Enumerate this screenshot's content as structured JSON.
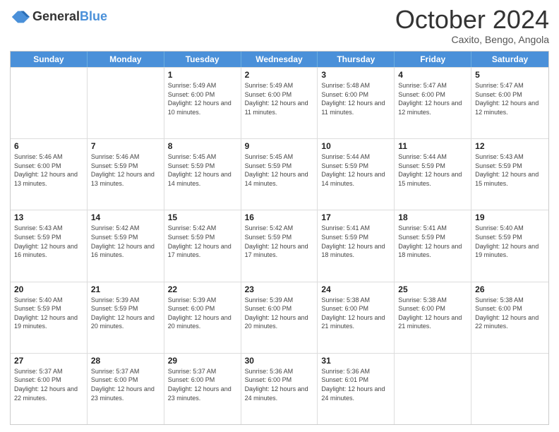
{
  "header": {
    "logo_general": "General",
    "logo_blue": "Blue",
    "month_title": "October 2024",
    "location": "Caxito, Bengo, Angola"
  },
  "days_of_week": [
    "Sunday",
    "Monday",
    "Tuesday",
    "Wednesday",
    "Thursday",
    "Friday",
    "Saturday"
  ],
  "weeks": [
    [
      {
        "day": "",
        "info": ""
      },
      {
        "day": "",
        "info": ""
      },
      {
        "day": "1",
        "info": "Sunrise: 5:49 AM\nSunset: 6:00 PM\nDaylight: 12 hours and 10 minutes."
      },
      {
        "day": "2",
        "info": "Sunrise: 5:49 AM\nSunset: 6:00 PM\nDaylight: 12 hours and 11 minutes."
      },
      {
        "day": "3",
        "info": "Sunrise: 5:48 AM\nSunset: 6:00 PM\nDaylight: 12 hours and 11 minutes."
      },
      {
        "day": "4",
        "info": "Sunrise: 5:47 AM\nSunset: 6:00 PM\nDaylight: 12 hours and 12 minutes."
      },
      {
        "day": "5",
        "info": "Sunrise: 5:47 AM\nSunset: 6:00 PM\nDaylight: 12 hours and 12 minutes."
      }
    ],
    [
      {
        "day": "6",
        "info": "Sunrise: 5:46 AM\nSunset: 6:00 PM\nDaylight: 12 hours and 13 minutes."
      },
      {
        "day": "7",
        "info": "Sunrise: 5:46 AM\nSunset: 5:59 PM\nDaylight: 12 hours and 13 minutes."
      },
      {
        "day": "8",
        "info": "Sunrise: 5:45 AM\nSunset: 5:59 PM\nDaylight: 12 hours and 14 minutes."
      },
      {
        "day": "9",
        "info": "Sunrise: 5:45 AM\nSunset: 5:59 PM\nDaylight: 12 hours and 14 minutes."
      },
      {
        "day": "10",
        "info": "Sunrise: 5:44 AM\nSunset: 5:59 PM\nDaylight: 12 hours and 14 minutes."
      },
      {
        "day": "11",
        "info": "Sunrise: 5:44 AM\nSunset: 5:59 PM\nDaylight: 12 hours and 15 minutes."
      },
      {
        "day": "12",
        "info": "Sunrise: 5:43 AM\nSunset: 5:59 PM\nDaylight: 12 hours and 15 minutes."
      }
    ],
    [
      {
        "day": "13",
        "info": "Sunrise: 5:43 AM\nSunset: 5:59 PM\nDaylight: 12 hours and 16 minutes."
      },
      {
        "day": "14",
        "info": "Sunrise: 5:42 AM\nSunset: 5:59 PM\nDaylight: 12 hours and 16 minutes."
      },
      {
        "day": "15",
        "info": "Sunrise: 5:42 AM\nSunset: 5:59 PM\nDaylight: 12 hours and 17 minutes."
      },
      {
        "day": "16",
        "info": "Sunrise: 5:42 AM\nSunset: 5:59 PM\nDaylight: 12 hours and 17 minutes."
      },
      {
        "day": "17",
        "info": "Sunrise: 5:41 AM\nSunset: 5:59 PM\nDaylight: 12 hours and 18 minutes."
      },
      {
        "day": "18",
        "info": "Sunrise: 5:41 AM\nSunset: 5:59 PM\nDaylight: 12 hours and 18 minutes."
      },
      {
        "day": "19",
        "info": "Sunrise: 5:40 AM\nSunset: 5:59 PM\nDaylight: 12 hours and 19 minutes."
      }
    ],
    [
      {
        "day": "20",
        "info": "Sunrise: 5:40 AM\nSunset: 5:59 PM\nDaylight: 12 hours and 19 minutes."
      },
      {
        "day": "21",
        "info": "Sunrise: 5:39 AM\nSunset: 5:59 PM\nDaylight: 12 hours and 20 minutes."
      },
      {
        "day": "22",
        "info": "Sunrise: 5:39 AM\nSunset: 6:00 PM\nDaylight: 12 hours and 20 minutes."
      },
      {
        "day": "23",
        "info": "Sunrise: 5:39 AM\nSunset: 6:00 PM\nDaylight: 12 hours and 20 minutes."
      },
      {
        "day": "24",
        "info": "Sunrise: 5:38 AM\nSunset: 6:00 PM\nDaylight: 12 hours and 21 minutes."
      },
      {
        "day": "25",
        "info": "Sunrise: 5:38 AM\nSunset: 6:00 PM\nDaylight: 12 hours and 21 minutes."
      },
      {
        "day": "26",
        "info": "Sunrise: 5:38 AM\nSunset: 6:00 PM\nDaylight: 12 hours and 22 minutes."
      }
    ],
    [
      {
        "day": "27",
        "info": "Sunrise: 5:37 AM\nSunset: 6:00 PM\nDaylight: 12 hours and 22 minutes."
      },
      {
        "day": "28",
        "info": "Sunrise: 5:37 AM\nSunset: 6:00 PM\nDaylight: 12 hours and 23 minutes."
      },
      {
        "day": "29",
        "info": "Sunrise: 5:37 AM\nSunset: 6:00 PM\nDaylight: 12 hours and 23 minutes."
      },
      {
        "day": "30",
        "info": "Sunrise: 5:36 AM\nSunset: 6:00 PM\nDaylight: 12 hours and 24 minutes."
      },
      {
        "day": "31",
        "info": "Sunrise: 5:36 AM\nSunset: 6:01 PM\nDaylight: 12 hours and 24 minutes."
      },
      {
        "day": "",
        "info": ""
      },
      {
        "day": "",
        "info": ""
      }
    ]
  ]
}
